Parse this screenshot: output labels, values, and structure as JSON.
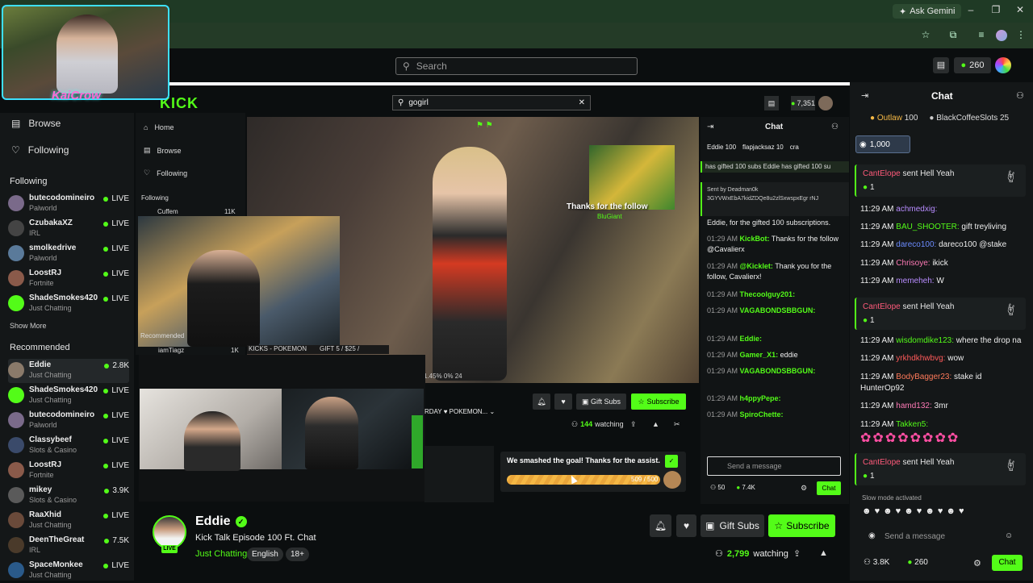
{
  "browser": {
    "ask_gemini": "Ask Gemini"
  },
  "header": {
    "search_placeholder": "Search",
    "points": "260"
  },
  "sidebar": {
    "browse": "Browse",
    "following": "Following",
    "following_label": "Following",
    "show_more": "Show More",
    "recommended_label": "Recommended",
    "following_channels": [
      {
        "name": "butecodomineiro",
        "category": "Palworld",
        "status": "LIVE",
        "color": "#7a6a8a"
      },
      {
        "name": "CzubakaXZ",
        "category": "IRL",
        "status": "LIVE",
        "color": "#444444"
      },
      {
        "name": "smolkedrive",
        "category": "Palworld",
        "status": "LIVE",
        "color": "#5a7a9a"
      },
      {
        "name": "LoostRJ",
        "category": "Fortnite",
        "status": "LIVE",
        "color": "#8a5a4a"
      },
      {
        "name": "ShadeSmokes420",
        "category": "Just Chatting",
        "status": "LIVE",
        "color": "#53fc18"
      }
    ],
    "recommended_channels": [
      {
        "name": "Eddie",
        "category": "Just Chatting",
        "status": "2.8K",
        "color": "#8a7a6a"
      },
      {
        "name": "ShadeSmokes420",
        "category": "Just Chatting",
        "status": "LIVE",
        "color": "#53fc18"
      },
      {
        "name": "butecodomineiro",
        "category": "Palworld",
        "status": "LIVE",
        "color": "#7a6a8a"
      },
      {
        "name": "Classybeef",
        "category": "Slots & Casino",
        "status": "LIVE",
        "color": "#3a4a6a"
      },
      {
        "name": "LoostRJ",
        "category": "Fortnite",
        "status": "LIVE",
        "color": "#8a5a4a"
      },
      {
        "name": "mikey",
        "category": "Slots & Casino",
        "status": "3.9K",
        "color": "#5a5a5a"
      },
      {
        "name": "RaaXhid",
        "category": "Just Chatting",
        "status": "LIVE",
        "color": "#6a4a3a"
      },
      {
        "name": "DeenTheGreat",
        "category": "IRL",
        "status": "7.5K",
        "color": "#4a3a2a"
      },
      {
        "name": "SpaceMonkee",
        "category": "Just Chatting",
        "status": "LIVE",
        "color": "#2a5a8a"
      }
    ]
  },
  "webcam": {
    "logo": "KaiCrow"
  },
  "inner": {
    "logo": "KICK",
    "search_value": "gogirl",
    "points": "7,351",
    "nav": [
      "Home",
      "Browse",
      "Following"
    ],
    "following_label": "Following",
    "cam_name": "Cuffem",
    "cam_count": "11K",
    "recommended_label": "Recommended",
    "rec_name": "iamTiagz",
    "rec_count": "1K",
    "ticker": [
      "KICKS - POKEMON",
      "GIFT 5 / $25 /"
    ],
    "video_progress": "1.45% 0% 24",
    "stream_title": "RDAY ♥ POKEMON...",
    "gift_subs": "Gift Subs",
    "subscribe": "Subscribe",
    "watching_count": "144",
    "watching_label": "watching",
    "follow_alert": "Thanks for the follow",
    "follow_name": "BluGiant",
    "goal_text": "We smashed the goal! Thanks for the assist.",
    "goal_count": "509 / 500",
    "goal_progress": 1.0,
    "chat_title": "Chat",
    "top_gifters": [
      "Eddie 100",
      "flapjacksaz 10",
      "cra"
    ],
    "gifted_banner": "has gifted 100 subs  Eddie has gifted 100 su",
    "pinned_by": "Sent by  Deadman0k",
    "pinned_text": "3GYVWxEbA7kidZDQe8u2zlSxwspxEgr rNJ",
    "messages": [
      {
        "time": "",
        "user": "",
        "text": "Eddie, for the gifted 100 subscriptions."
      },
      {
        "time": "01:29 AM",
        "user": "KickBot:",
        "text": "Thanks for the follow @Cavalierx"
      },
      {
        "time": "01:29 AM",
        "user": "@Kicklet:",
        "text": "Thank you for the follow, Cavalierx!"
      },
      {
        "time": "01:29 AM",
        "user": "Thecoolguy201:",
        "text": ""
      },
      {
        "time": "01:29 AM",
        "user": "VAGABONDSBBGUN:",
        "text": ""
      },
      {
        "time": "01:29 AM",
        "user": "Eddie:",
        "text": ""
      },
      {
        "time": "01:29 AM",
        "user": "Gamer_X1:",
        "text": "eddie"
      },
      {
        "time": "01:29 AM",
        "user": "VAGABONDSBBGUN:",
        "text": ""
      },
      {
        "time": "01:29 AM",
        "user": "h4ppyPepe:",
        "text": ""
      },
      {
        "time": "01:29 AM",
        "user": "SpiroChette:",
        "text": ""
      }
    ],
    "send_placeholder": "Send a message",
    "chat_button": "Chat",
    "stat_users": "50",
    "stat_points": "7.4K"
  },
  "stream": {
    "streamer": "Eddie",
    "live": "LIVE",
    "title": "Kick Talk Episode 100 Ft. Chat",
    "category": "Just Chatting",
    "tags": [
      "English",
      "18+"
    ],
    "gift_subs": "Gift Subs",
    "subscribe": "Subscribe",
    "watching_count": "2,799",
    "watching_label": "watching"
  },
  "chat": {
    "title": "Chat",
    "leaders": [
      {
        "name": "Outlaw",
        "amount": "100"
      },
      {
        "name": "BlackCoffeeSlots",
        "amount": "25"
      }
    ],
    "gift_pill": "1,000",
    "sub_cards": [
      {
        "user": "CantElope",
        "text": " sent Hell Yeah",
        "count": "1"
      },
      {
        "user": "CantElope",
        "text": " sent Hell Yeah",
        "count": "1"
      },
      {
        "user": "CantElope",
        "text": " sent Hell Yeah",
        "count": "1"
      }
    ],
    "messages_a": [
      {
        "time": "11:29 AM",
        "user": "achmedxig:",
        "text": "",
        "color": "#b88cff"
      },
      {
        "time": "11:29 AM",
        "user": "BAU_SHOOTER:",
        "text": " gift treyliving",
        "color": "#53fc18"
      },
      {
        "time": "11:29 AM",
        "user": "dareco100:",
        "text": " dareco100 @stake",
        "color": "#6c8cff"
      },
      {
        "time": "11:29 AM",
        "user": "Chrisoye:",
        "text": " ikick",
        "color": "#ff7ab6"
      },
      {
        "time": "11:29 AM",
        "user": "memeheh:",
        "text": " W",
        "color": "#b88cff"
      }
    ],
    "messages_b": [
      {
        "time": "11:29 AM",
        "user": "wisdomdike123:",
        "text": " where the drop na",
        "color": "#53fc18"
      },
      {
        "time": "11:29 AM",
        "user": "yrkhdkhwbvg:",
        "text": " wow",
        "color": "#ff5a5a"
      },
      {
        "time": "11:29 AM",
        "user": "BodyBagger23:",
        "text": " stake id HunterOp92",
        "color": "#ff7a5a"
      },
      {
        "time": "11:29 AM",
        "user": "hamd132:",
        "text": " 3mr",
        "color": "#ff7ab6"
      },
      {
        "time": "11:29 AM",
        "user": "Takken5:",
        "text": "",
        "color": "#53fc18"
      }
    ],
    "slow_mode": "Slow mode activated",
    "send_placeholder": "Send a message",
    "stat_users": "3.8K",
    "stat_points": "260",
    "chat_button": "Chat"
  },
  "colors": {
    "accent": "#53fc18",
    "background": "#0b0e0f",
    "panel": "#141718"
  }
}
